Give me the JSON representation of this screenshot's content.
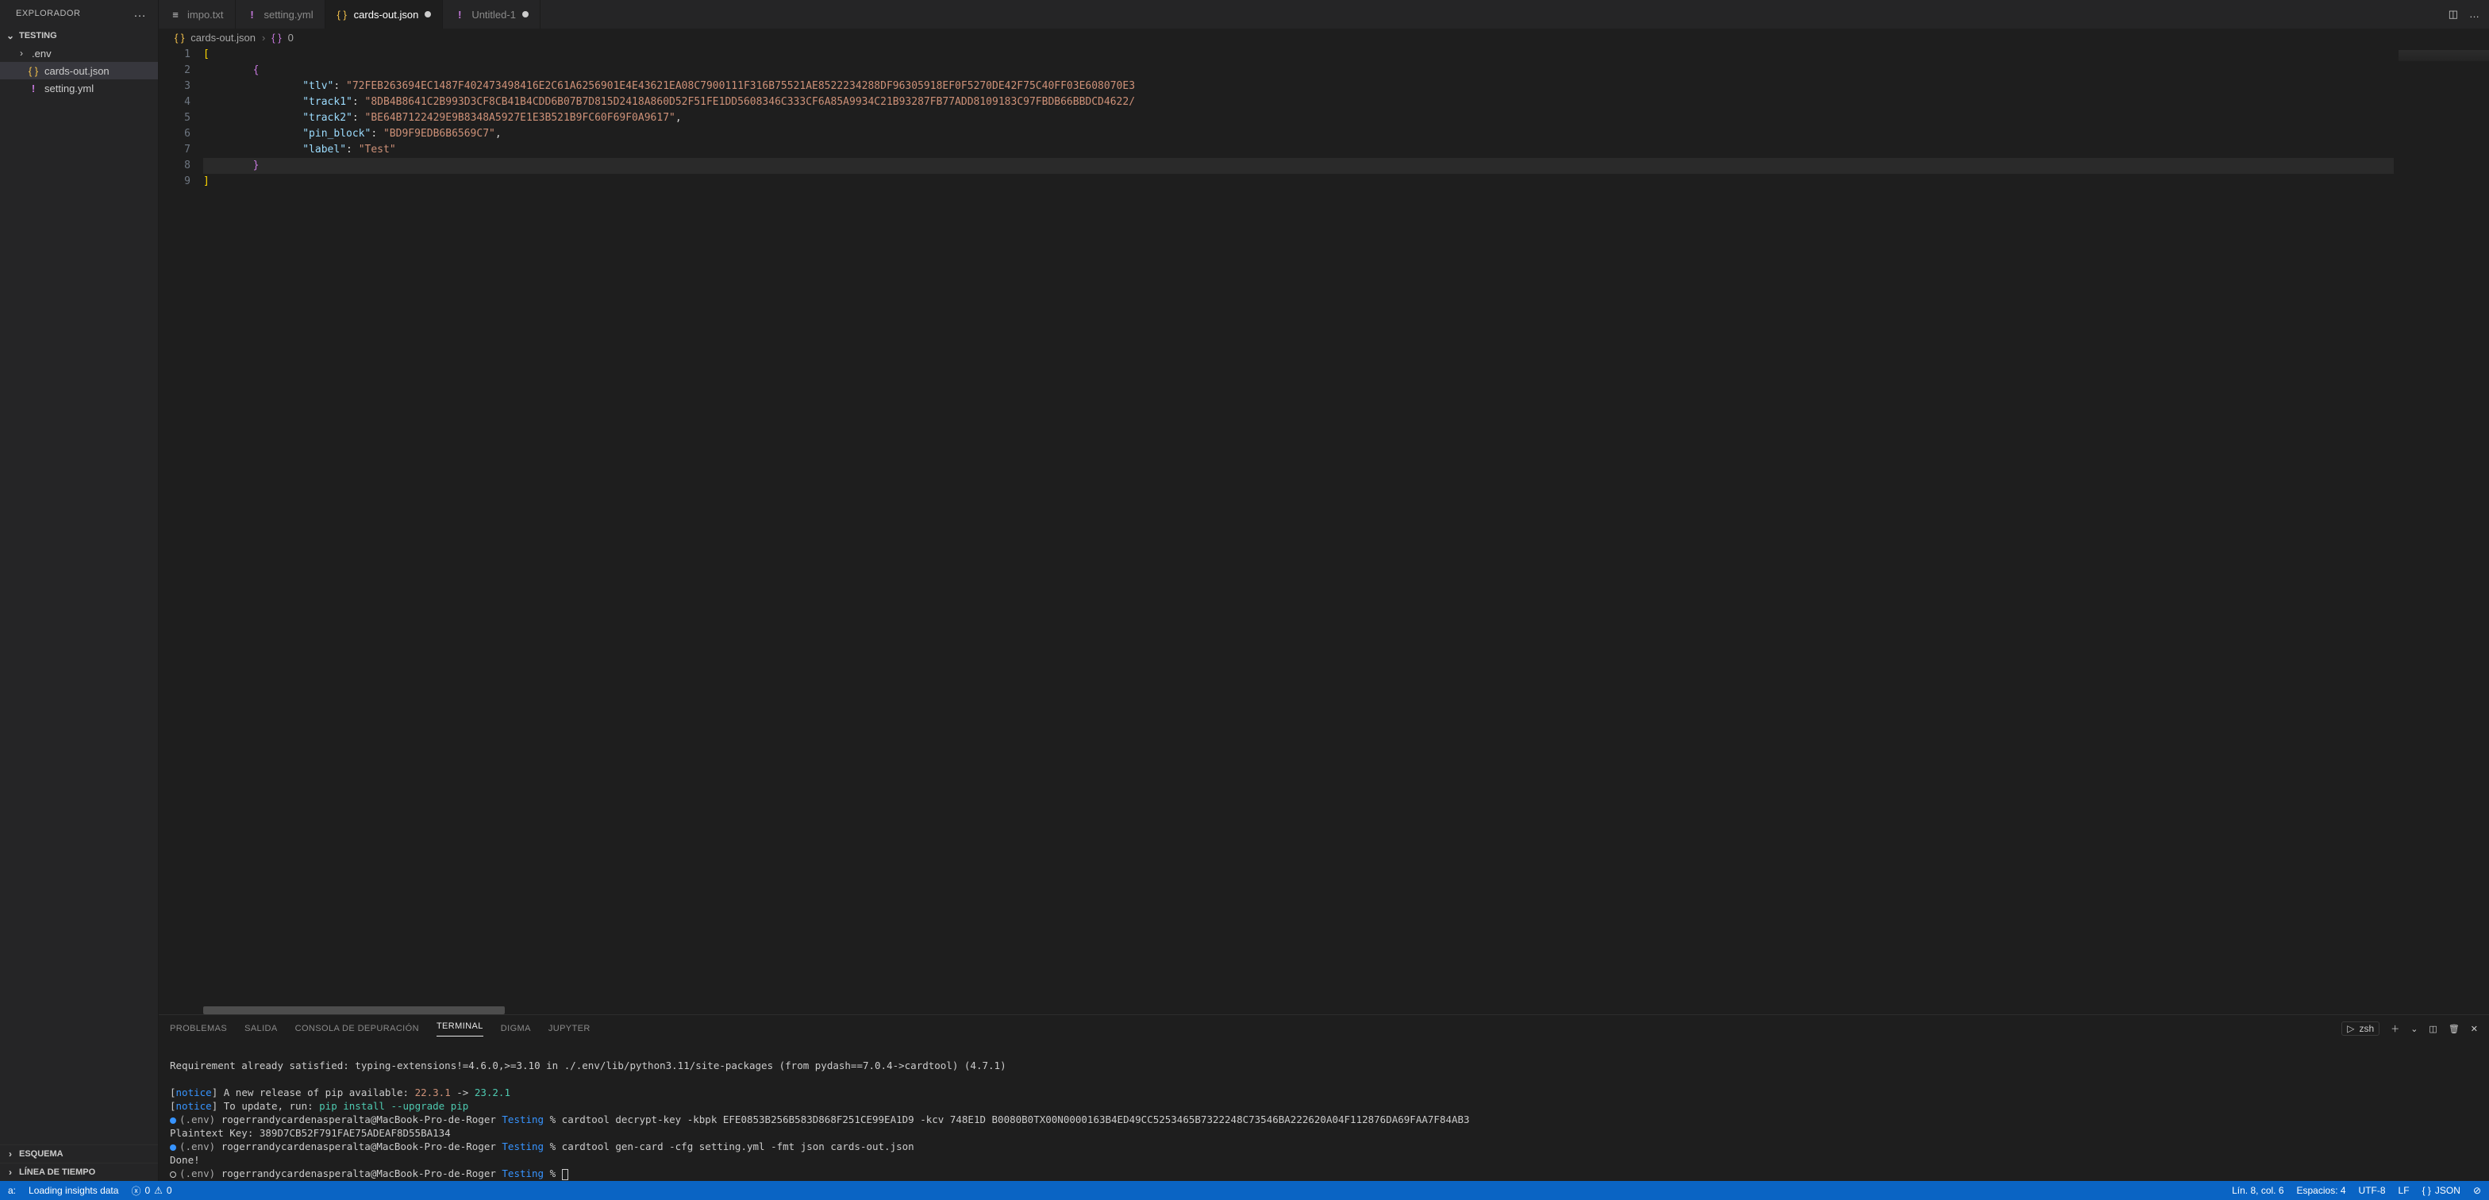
{
  "sidebar": {
    "title": "EXPLORADOR",
    "workspace": "TESTING",
    "items": [
      {
        "label": ".env",
        "iconClass": "",
        "chevron": "›",
        "child": false
      },
      {
        "label": "cards-out.json",
        "iconClass": "json",
        "iconGlyph": "{ }",
        "child": true,
        "selected": true
      },
      {
        "label": "setting.yml",
        "iconClass": "yaml",
        "iconGlyph": "!",
        "child": true
      }
    ],
    "sections": [
      {
        "label": "ESQUEMA"
      },
      {
        "label": "LÍNEA DE TIEMPO"
      }
    ]
  },
  "tabs": [
    {
      "label": "impo.txt",
      "iconClass": "txt",
      "iconGlyph": "≡",
      "active": false,
      "dirty": false
    },
    {
      "label": "setting.yml",
      "iconClass": "yaml",
      "iconGlyph": "!",
      "active": false,
      "dirty": false
    },
    {
      "label": "cards-out.json",
      "iconClass": "json",
      "iconGlyph": "{ }",
      "active": true,
      "dirty": true
    },
    {
      "label": "Untitled-1",
      "iconClass": "yaml",
      "iconGlyph": "!",
      "active": false,
      "dirty": true
    }
  ],
  "breadcrumb": {
    "fileIcon": "{ }",
    "file": "cards-out.json",
    "symbolIcon": "{ }",
    "symbol": "0"
  },
  "code": {
    "lines": [
      {
        "n": 1,
        "indent": 0,
        "html": "<span class='tok-br'>[</span>"
      },
      {
        "n": 2,
        "indent": 2,
        "html": "<span class='tok-br2'>{</span>"
      },
      {
        "n": 3,
        "indent": 4,
        "html": "<span class='tok-key'>\"tlv\"</span><span class='tok-pun'>: </span><span class='tok-str'>\"72FEB263694EC1487F402473498416E2C61A6256901E4E43621EA08C7900111F316B75521AE8522234288DF96305918EF0F5270DE42F75C40FF03E608070E3</span>"
      },
      {
        "n": 4,
        "indent": 4,
        "html": "<span class='tok-key'>\"track1\"</span><span class='tok-pun'>: </span><span class='tok-str'>\"8DB4B8641C2B993D3CF8CB41B4CDD6B07B7D815D2418A860D52F51FE1DD5608346C333CF6A85A9934C21B93287FB77ADD8109183C97FBDB66BBDCD4622/</span>"
      },
      {
        "n": 5,
        "indent": 4,
        "html": "<span class='tok-key'>\"track2\"</span><span class='tok-pun'>: </span><span class='tok-str'>\"BE64B7122429E9B8348A5927E1E3B521B9FC60F69F0A9617\"</span><span class='tok-pun'>,</span>"
      },
      {
        "n": 6,
        "indent": 4,
        "html": "<span class='tok-key'>\"pin_block\"</span><span class='tok-pun'>: </span><span class='tok-str'>\"BD9F9EDB6B6569C7\"</span><span class='tok-pun'>,</span>"
      },
      {
        "n": 7,
        "indent": 4,
        "html": "<span class='tok-key'>\"label\"</span><span class='tok-pun'>: </span><span class='tok-str'>\"Test\"</span>"
      },
      {
        "n": 8,
        "indent": 2,
        "html": "<span class='tok-br2'>}</span>",
        "current": true
      },
      {
        "n": 9,
        "indent": 0,
        "html": "<span class='tok-br'>]</span>"
      }
    ]
  },
  "panel": {
    "tabs": [
      "PROBLEMAS",
      "SALIDA",
      "CONSOLA DE DEPURACIÓN",
      "TERMINAL",
      "DIGMA",
      "JUPYTER"
    ],
    "active": "TERMINAL",
    "shell": "zsh"
  },
  "terminal": {
    "l1": "Requirement already satisfied: typing-extensions!=4.6.0,>=3.10 in ./.env/lib/python3.11/site-packages (from pydash==7.0.4->cardtool) (4.7.1)",
    "n1a": "[",
    "n1b": "notice",
    "n1c": "] A new release of pip available: ",
    "ver_old": "22.3.1",
    "arrow": " -> ",
    "ver_new": "23.2.1",
    "n2a": "[",
    "n2b": "notice",
    "n2c": "] To update, run: ",
    "pipcmd": "pip install --upgrade pip",
    "p1_env": "(.env) ",
    "p1_userhost": "rogerrandycardenasperalta@MacBook-Pro-de-Roger",
    "p1_dir": " Testing ",
    "p1_sym": "% ",
    "cmd1": "cardtool decrypt-key -kbpk EFE0853B256B583D868F251CE99EA1D9 -kcv 748E1D B0080B0TX00N0000163B4ED49CC5253465B7322248C73546BA222620A04F112876DA69FAA7F84AB3",
    "out1": "Plaintext Key: 389D7CB52F791FAE75ADEAF8D55BA134",
    "cmd2": "cardtool gen-card -cfg setting.yml -fmt json cards-out.json",
    "out2": "Done!"
  },
  "status": {
    "left1": "a:",
    "loading": "Loading insights data",
    "err": "0",
    "warn": "0",
    "pos": "Lín. 8, col. 6",
    "spaces": "Espacios: 4",
    "enc": "UTF-8",
    "eol": "LF",
    "lang": "JSON",
    "langIcon": "{ }"
  }
}
